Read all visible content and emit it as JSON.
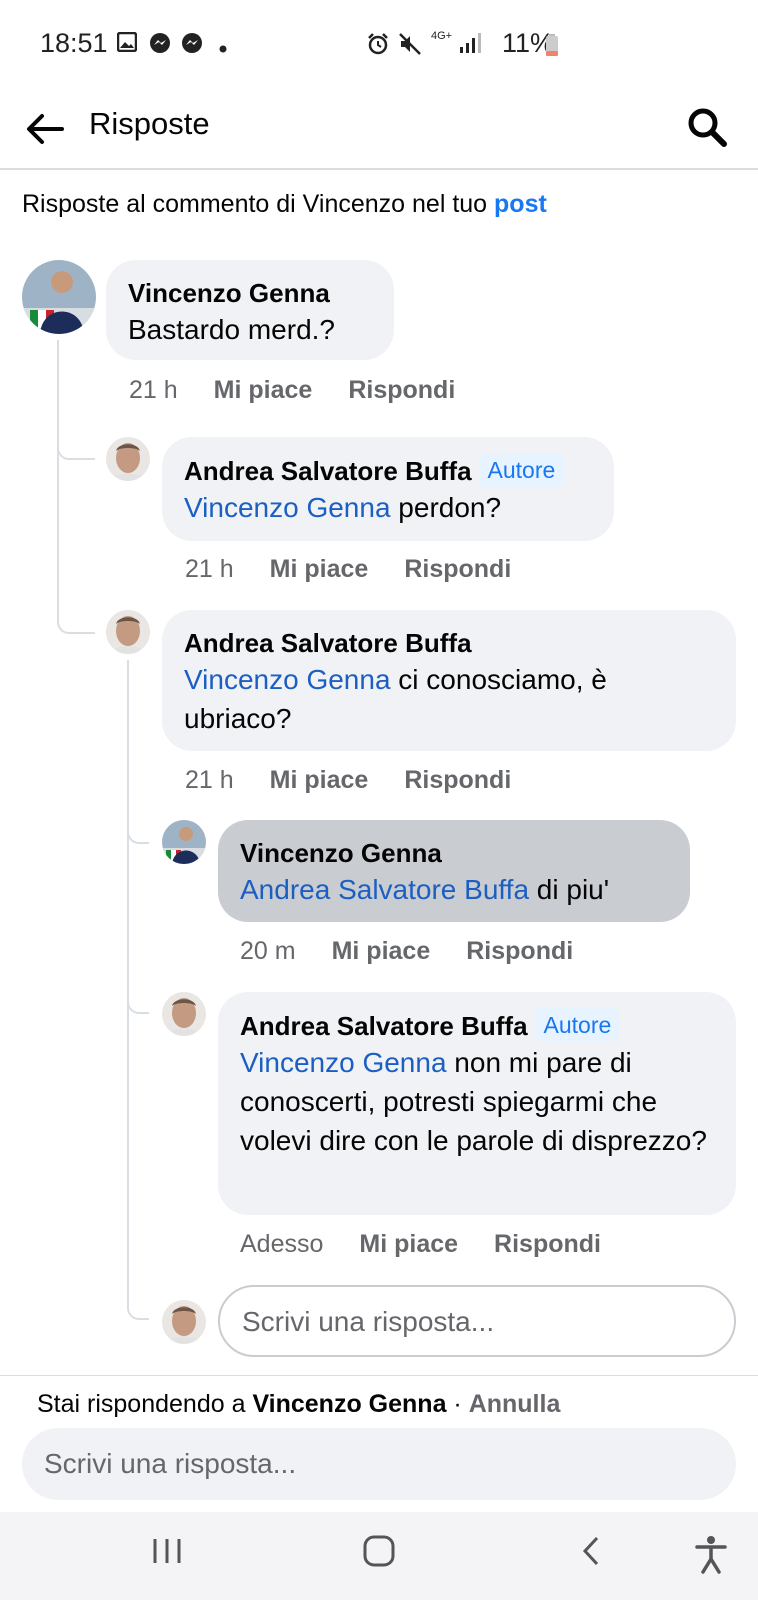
{
  "status_bar": {
    "time": "18:51",
    "network": "4G+",
    "battery": "11%",
    "icons": [
      "image-icon",
      "messenger-icon",
      "messenger-icon",
      "dot-icon",
      "alarm-icon",
      "mute-icon",
      "network-icon",
      "signal-icon",
      "battery-icon"
    ]
  },
  "header": {
    "title": "Risposte"
  },
  "subheader": {
    "text": "Risposte al commento di Vincenzo nel tuo ",
    "link": "post"
  },
  "comments": [
    {
      "author": "Vincenzo Genna",
      "badge": "",
      "mention": "",
      "text": "Bastardo merd.?",
      "time": "21 h",
      "like": "Mi piace",
      "reply": "Rispondi"
    },
    {
      "author": "Andrea Salvatore Buffa",
      "badge": "Autore",
      "mention": "Vincenzo Genna",
      "text": " perdon?",
      "time": "21 h",
      "like": "Mi piace",
      "reply": "Rispondi"
    },
    {
      "author": "Andrea Salvatore Buffa",
      "badge": "",
      "mention": "Vincenzo Genna",
      "text": " ci conosciamo, è ubriaco?",
      "time": "21 h",
      "like": "Mi piace",
      "reply": "Rispondi"
    },
    {
      "author": "Vincenzo Genna",
      "badge": "",
      "mention": "Andrea Salvatore Buffa",
      "text": " di piu'",
      "time": "20 m",
      "like": "Mi piace",
      "reply": "Rispondi"
    },
    {
      "author": "Andrea Salvatore Buffa",
      "badge": "Autore",
      "mention": "Vincenzo Genna",
      "text": " non mi pare di conoscerti, potresti spiegarmi che volevi dire con le parole di disprezzo?",
      "time": "Adesso",
      "like": "Mi piace",
      "reply": "Rispondi"
    }
  ],
  "inline_reply": {
    "placeholder": "Scrivi una risposta..."
  },
  "composer": {
    "replying_prefix": "Stai rispondendo a ",
    "replying_to": "Vincenzo Genna",
    "separator": " · ",
    "cancel": "Annulla",
    "placeholder": "Scrivi una risposta..."
  },
  "colors": {
    "link": "#1877f2",
    "mention": "#1c5fc2",
    "bubble": "#f0f2f5",
    "bubble_selected": "#c9ccd1",
    "secondary_text": "#65676b"
  }
}
